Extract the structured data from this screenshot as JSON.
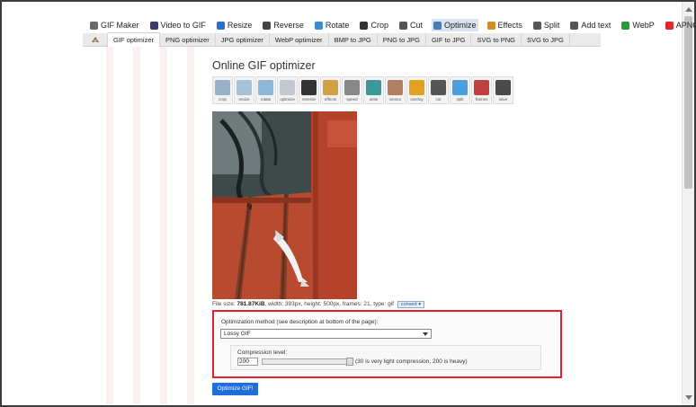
{
  "topnav": [
    {
      "label": "GIF Maker",
      "icon": "gif-maker-icon",
      "color": "#6a6a6a",
      "active": false
    },
    {
      "label": "Video to GIF",
      "icon": "video-icon",
      "color": "#3a3a6a",
      "active": false
    },
    {
      "label": "Resize",
      "icon": "resize-icon",
      "color": "#2a6fd0",
      "active": false
    },
    {
      "label": "Reverse",
      "icon": "reverse-icon",
      "color": "#444444",
      "active": false
    },
    {
      "label": "Rotate",
      "icon": "rotate-icon",
      "color": "#3a8ad0",
      "active": false
    },
    {
      "label": "Crop",
      "icon": "crop-icon",
      "color": "#333333",
      "active": false
    },
    {
      "label": "Cut",
      "icon": "scissors-icon",
      "color": "#555555",
      "active": false
    },
    {
      "label": "Optimize",
      "icon": "optimize-icon",
      "color": "#4a7ab0",
      "active": true
    },
    {
      "label": "Effects",
      "icon": "effects-icon",
      "color": "#d08a2a",
      "active": false
    },
    {
      "label": "Split",
      "icon": "split-icon",
      "color": "#555555",
      "active": false
    },
    {
      "label": "Add text",
      "icon": "add-text-icon",
      "color": "#555555",
      "active": false
    },
    {
      "label": "WebP",
      "icon": "webp-icon",
      "color": "#2a9a3a",
      "active": false
    },
    {
      "label": "APNG",
      "icon": "apng-icon",
      "color": "#e02a2a",
      "active": false
    }
  ],
  "subnav": [
    {
      "label": "GIF optimizer",
      "active": true
    },
    {
      "label": "PNG optimizer",
      "active": false
    },
    {
      "label": "JPG optimizer",
      "active": false
    },
    {
      "label": "WebP optimizer",
      "active": false
    },
    {
      "label": "BMP to JPG",
      "active": false
    },
    {
      "label": "PNG to JPG",
      "active": false
    },
    {
      "label": "GIF to JPG",
      "active": false
    },
    {
      "label": "SVG to PNG",
      "active": false
    },
    {
      "label": "SVG to JPG",
      "active": false
    }
  ],
  "page_title": "Online GIF optimizer",
  "tools": [
    {
      "label": "crop",
      "icon": "crop-tool-icon",
      "color": "#9ab0c8"
    },
    {
      "label": "resize",
      "icon": "resize-tool-icon",
      "color": "#a8c0d8"
    },
    {
      "label": "rotate",
      "icon": "rotate-tool-icon",
      "color": "#8fb8d8"
    },
    {
      "label": "optimize",
      "icon": "optimize-tool-icon",
      "color": "#c0c8d0"
    },
    {
      "label": "reverse",
      "icon": "reverse-tool-icon",
      "color": "#333333"
    },
    {
      "label": "effects",
      "icon": "effects-tool-icon",
      "color": "#d0a040"
    },
    {
      "label": "speed",
      "icon": "speed-tool-icon",
      "color": "#888888"
    },
    {
      "label": "write",
      "icon": "write-tool-icon",
      "color": "#3a9a9a"
    },
    {
      "label": "censor",
      "icon": "censor-tool-icon",
      "color": "#b08060"
    },
    {
      "label": "overlay",
      "icon": "overlay-tool-icon",
      "color": "#e0a020"
    },
    {
      "label": "cut",
      "icon": "cut-tool-icon",
      "color": "#555555"
    },
    {
      "label": "split",
      "icon": "split-tool-icon",
      "color": "#4aa0e0"
    },
    {
      "label": "frames",
      "icon": "frames-tool-icon",
      "color": "#c04040"
    },
    {
      "label": "save",
      "icon": "save-tool-icon",
      "color": "#4a4a4a"
    }
  ],
  "fileinfo": {
    "prefix": "File size: ",
    "size": "781.87KiB",
    "rest": ", width: 393px, height: 500px, frames: 21, type: gif",
    "convert_label": "convert"
  },
  "optimization": {
    "method_label": "Optimization method (see description at bottom of the page):",
    "method_value": "Lossy GIF",
    "compression_label": "Compression level:",
    "compression_value": "200",
    "compression_level_fraction": 1.0,
    "compression_hint": "(30 is very light compression, 200 is heavy)"
  },
  "optimize_button": "Optimize GIF!",
  "colors": {
    "highlight_border": "#e0202a",
    "primary_button": "#1e6fd9"
  }
}
